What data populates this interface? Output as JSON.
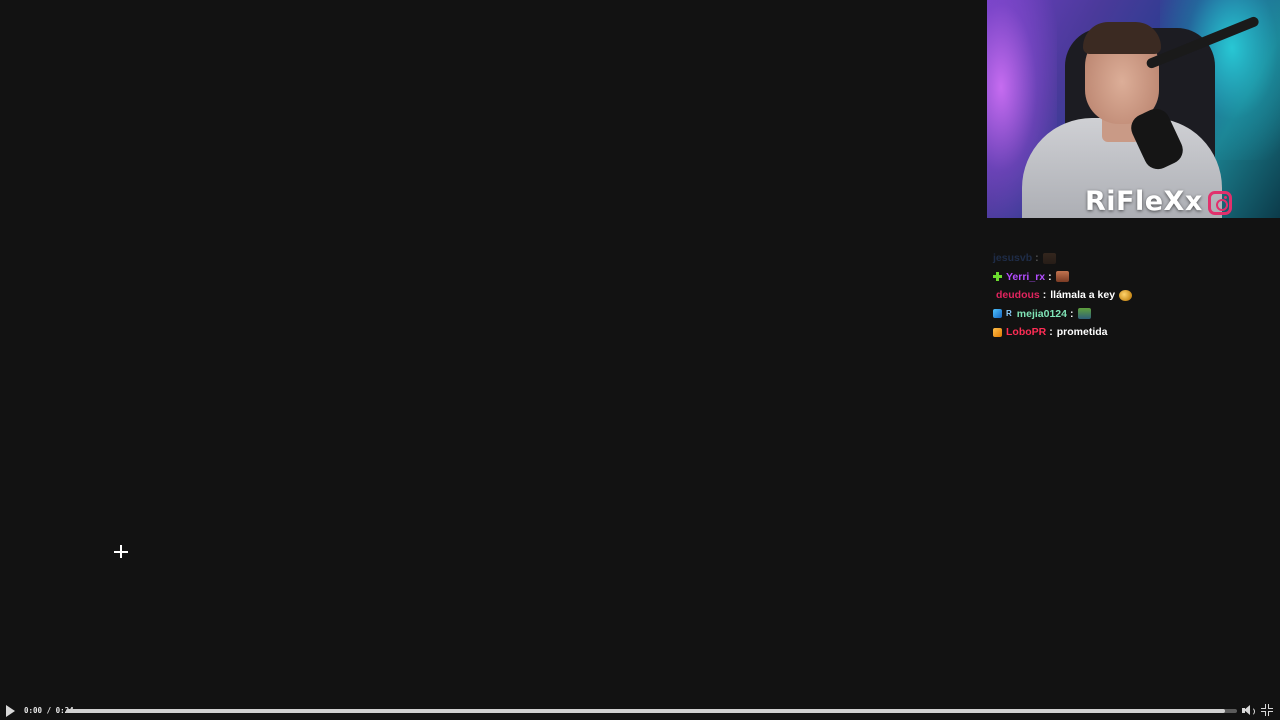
{
  "webcam": {
    "streamer_name": "RiFleXx",
    "social_icon": "instagram-icon",
    "accent_color": "#e1306c"
  },
  "chat": {
    "messages": [
      {
        "username": "jesusvb",
        "color": "#3f6fd0",
        "badges": [],
        "text": "",
        "emote": "brown-emote",
        "faded": true
      },
      {
        "username": "Yerri_rx",
        "color": "#b34dff",
        "badges": [
          "plus-badge"
        ],
        "text": "",
        "emote": "face-emote"
      },
      {
        "username": "deudous",
        "color": "#e0245e",
        "badges": [],
        "text": "llámala a key",
        "emote": "gold-emote"
      },
      {
        "username": "mejia0124",
        "color": "#7fe3b6",
        "badges": [
          "cube-badge",
          "R"
        ],
        "text": "",
        "emote": "green-emote"
      },
      {
        "username": "LoboPR",
        "color": "#ff2d55",
        "badges": [
          "cube-badge"
        ],
        "text": "prometida",
        "emote": ""
      }
    ]
  },
  "controls": {
    "current_time": "0:00",
    "separator": " / ",
    "duration": "0:24",
    "progress": 0.99,
    "play_icon": "play-icon",
    "volume_icon": "volume-icon",
    "fullscreen_icon": "fullscreen-icon",
    "seek_fill_color": "#d0d0d0",
    "seek_track_color": "#5b5b5b"
  },
  "cursor": {
    "icon": "crosshair-cursor-icon"
  }
}
